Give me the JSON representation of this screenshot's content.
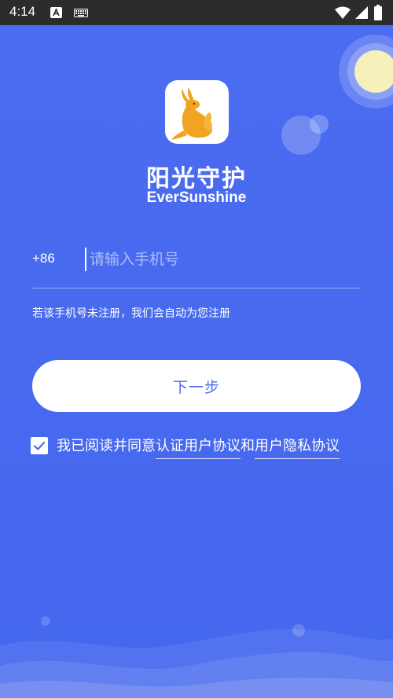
{
  "status_bar": {
    "time": "4:14"
  },
  "app": {
    "title": "阳光守护",
    "subtitle": "EverSunshine"
  },
  "login": {
    "country_code": "+86",
    "phone_placeholder": "请输入手机号",
    "phone_value": "",
    "hint": "若该手机号未注册，我们会自动为您注册",
    "next_button": "下一步"
  },
  "agreement": {
    "checked": true,
    "prefix": "我已阅读并同意",
    "user_agreement": "认证用户协议",
    "connector": "和",
    "privacy_policy": "用户隐私协议"
  },
  "colors": {
    "background": "#4a6cf0",
    "button_text": "#4a6cf0",
    "status_bar": "#2c2c2c",
    "sun": "#f6f0bb",
    "logo_kangaroo": "#f0a422"
  },
  "icons": {
    "status": [
      "a-icon",
      "keyboard-icon",
      "wifi-icon",
      "signal-icon",
      "battery-icon"
    ],
    "logo": "kangaroo-icon",
    "checkbox": "checkmark-icon"
  }
}
